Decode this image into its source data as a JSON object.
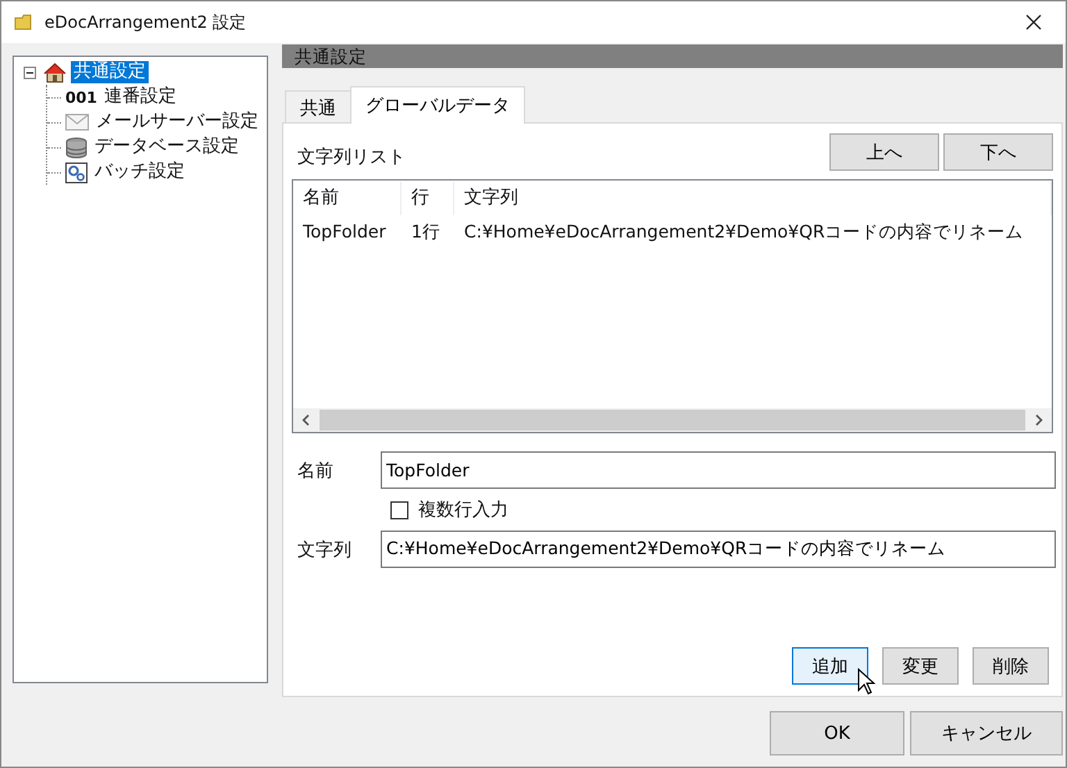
{
  "window": {
    "title": "eDocArrangement2 設定"
  },
  "tree": [
    {
      "label": "共通設定",
      "kind": "house",
      "selected": true,
      "expanded": true,
      "children": [
        {
          "label": "連番設定",
          "kind": "counter",
          "badge": "001",
          "selected": false
        },
        {
          "label": "メールサーバー設定",
          "kind": "mail",
          "selected": false
        },
        {
          "label": "データベース設定",
          "kind": "database",
          "selected": false
        },
        {
          "label": "バッチ設定",
          "kind": "batch",
          "selected": false
        }
      ]
    }
  ],
  "section_header": "共通設定",
  "tabs": [
    {
      "label": "共通",
      "selected": false
    },
    {
      "label": "グローバルデータ",
      "selected": true
    }
  ],
  "list": {
    "title": "文字列リスト",
    "buttons": [
      "上へ",
      "下へ"
    ],
    "columns": [
      "名前",
      "行",
      "文字列"
    ],
    "rows": [
      {
        "cells": [
          "TopFolder",
          "1行",
          "C:¥Home¥eDocArrangement2¥Demo¥QRコードの内容でリネーム"
        ]
      }
    ]
  },
  "form": {
    "name_label": "名前",
    "name_value": "TopFolder",
    "multiline": {
      "label": "複数行入力",
      "checked": false
    },
    "string_label": "文字列",
    "string_value": "C:¥Home¥eDocArrangement2¥Demo¥QRコードの内容でリネーム"
  },
  "actions": [
    {
      "label": "追加",
      "focused": true
    },
    {
      "label": "変更",
      "focused": false
    },
    {
      "label": "削除",
      "focused": false
    }
  ],
  "footer_buttons": [
    "OK",
    "キャンセル"
  ]
}
